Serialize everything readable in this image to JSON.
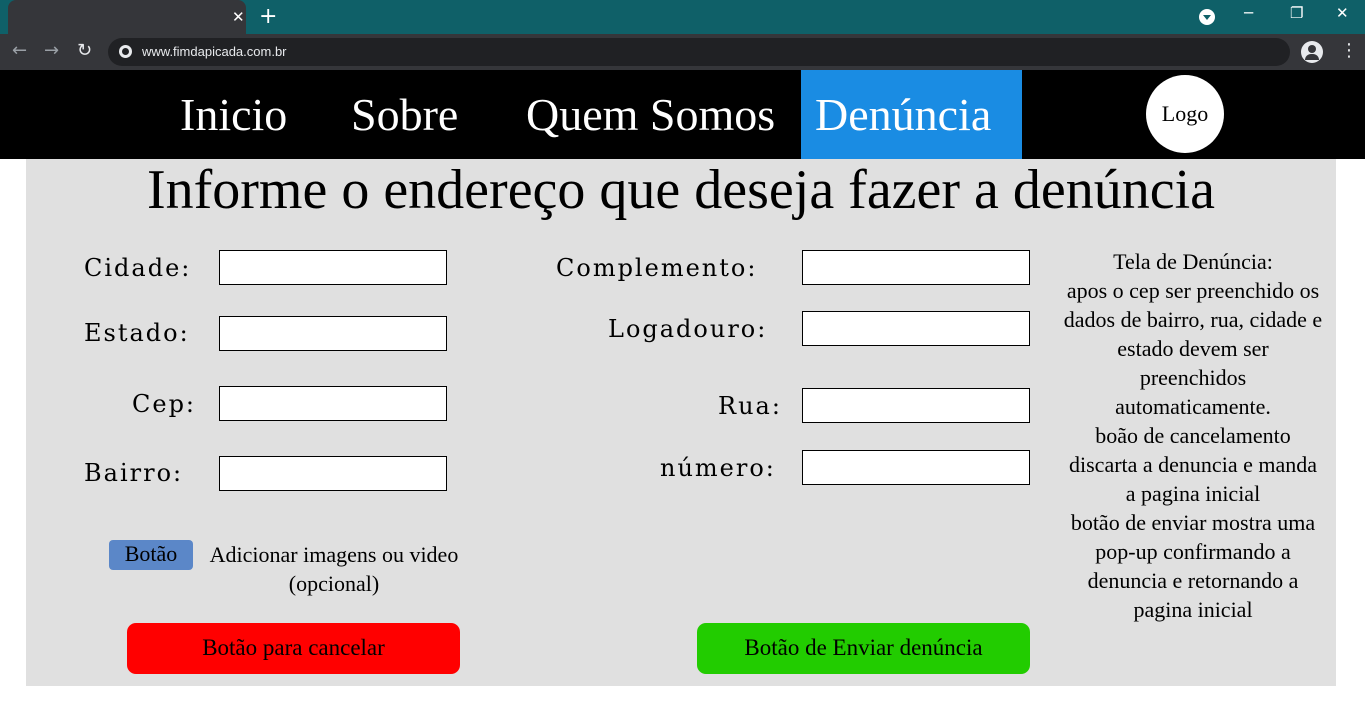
{
  "browser": {
    "url": "www.fimdapicada.com.br"
  },
  "nav": {
    "items": [
      "Inicio",
      "Sobre",
      "Quem Somos",
      "Denúncia"
    ],
    "active": "Denúncia",
    "logo": "Logo"
  },
  "main": {
    "heading": "Informe o endereço que deseja fazer a denúncia",
    "labels": {
      "cidade": "Cidade:",
      "estado": "Estado:",
      "cep": "Cep:",
      "bairro": "Bairro:",
      "complemento": "Complemento:",
      "logadouro": "Logadouro:",
      "rua": "Rua:",
      "numero": "número:"
    },
    "upload_button": "Botão",
    "upload_text": "Adicionar imagens ou video (opcional)",
    "cancel_button": "Botão para cancelar",
    "send_button": "Botão de Enviar denúncia",
    "note": "Tela de Denúncia:\napos o cep ser preenchido os dados de bairro, rua, cidade e estado devem ser preenchidos automaticamente.\nboão de cancelamento discarta a denuncia e manda a pagina inicial\nbotão de enviar mostra uma pop-up confirmando a denuncia e retornando a pagina inicial"
  },
  "colors": {
    "nav_active": "#1a8ce3",
    "cancel": "#ff0000",
    "send": "#22cc00",
    "upload": "#5b87c8"
  }
}
